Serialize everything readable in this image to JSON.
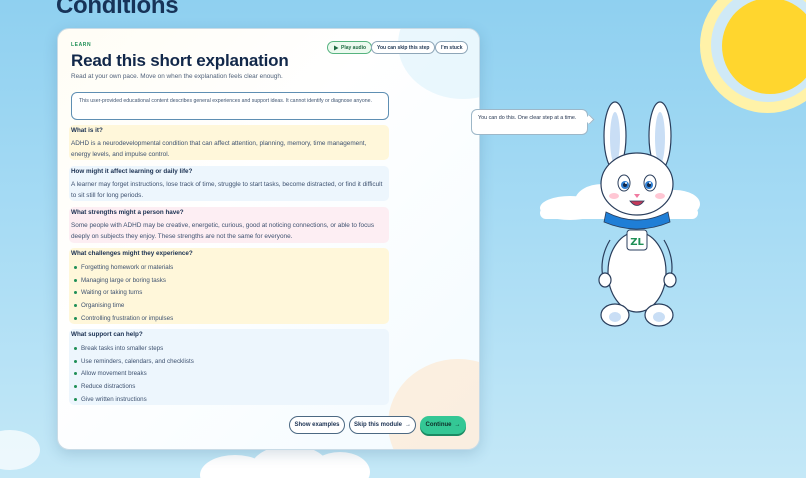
{
  "page": {
    "heading": "Conditions"
  },
  "colors": {
    "accent_green": "#34c795",
    "eyebrow_green": "#1f8f56",
    "title_navy": "#12284a",
    "sky_blue": "#9ed7f2",
    "sun_yellow": "#ffd62e"
  },
  "card": {
    "eyebrow": "LEARN",
    "title": "Read this short explanation",
    "subtitle": "Read at your own pace. Move on when the explanation feels clear enough.",
    "top_actions": {
      "play_audio_label": "Play audio",
      "play_audio_icon": "play-icon",
      "skip_step_label": "You can skip this step",
      "stuck_label": "I'm stuck"
    },
    "disclaimer": "This user-provided educational content describes general experiences and support ideas. It cannot identify or diagnose anyone.",
    "sections": [
      {
        "question": "What is it?",
        "answer": "ADHD is a neurodevelopmental condition that can affect attention, planning, memory, time management, energy levels, and impulse control.",
        "bg": "#fff7da"
      },
      {
        "question": "How might it affect learning or daily life?",
        "answer": "A learner may forget instructions, lose track of time, struggle to start tasks, become distracted, or find it difficult to sit still for long periods.",
        "bg": "#edf6fd"
      },
      {
        "question": "What strengths might a person have?",
        "answer": "Some people with ADHD may be creative, energetic, curious, good at noticing connections, or able to focus deeply on subjects they enjoy. These strengths are not the same for everyone.",
        "bg": "#fdeef3"
      },
      {
        "question": "What challenges might they experience?",
        "bg": "#fff7da",
        "items": [
          "Forgetting homework or materials",
          "Managing large or boring tasks",
          "Waiting or taking turns",
          "Organising time",
          "Controlling frustration or impulses"
        ]
      },
      {
        "question": "What support can help?",
        "bg": "#edf6fd",
        "items": [
          "Break tasks into smaller steps",
          "Use reminders, calendars, and checklists",
          "Allow movement breaks",
          "Reduce distractions",
          "Give written instructions"
        ]
      }
    ],
    "footer": {
      "show_examples_label": "Show examples",
      "skip_module_label": "Skip this module",
      "skip_module_icon": "arrow-right-icon",
      "continue_label": "Continue",
      "continue_icon": "arrow-right-icon"
    }
  },
  "mascot": {
    "speech": "You can do this. One clear step at a time.",
    "badge_icon": "zl-logo-badge-icon"
  }
}
